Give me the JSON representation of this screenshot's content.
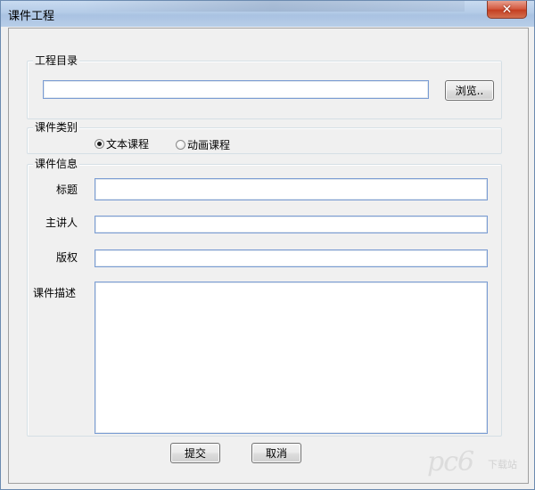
{
  "window": {
    "title": "课件工程",
    "close_glyph": "✕"
  },
  "project_dir": {
    "group_title": "工程目录",
    "path_value": "",
    "browse_label": "浏览.."
  },
  "course_type": {
    "group_title": "课件类别",
    "options": [
      {
        "label": "文本课程",
        "checked": true
      },
      {
        "label": "动画课程",
        "checked": false
      }
    ]
  },
  "course_info": {
    "group_title": "课件信息",
    "fields": {
      "title_label": "标题",
      "title_value": "",
      "speaker_label": "主讲人",
      "speaker_value": "",
      "copyright_label": "版权",
      "copyright_value": "",
      "description_label": "课件描述",
      "description_value": ""
    }
  },
  "actions": {
    "submit_label": "提交",
    "cancel_label": "取消"
  },
  "watermark": {
    "logo_text": "pc6",
    "sub_text": "下载站"
  },
  "colors": {
    "titlebar": "#b4cbe7",
    "close_button": "#c43d20",
    "textbox_border": "#7a9cd3",
    "window_bg": "#f0f0f0"
  }
}
